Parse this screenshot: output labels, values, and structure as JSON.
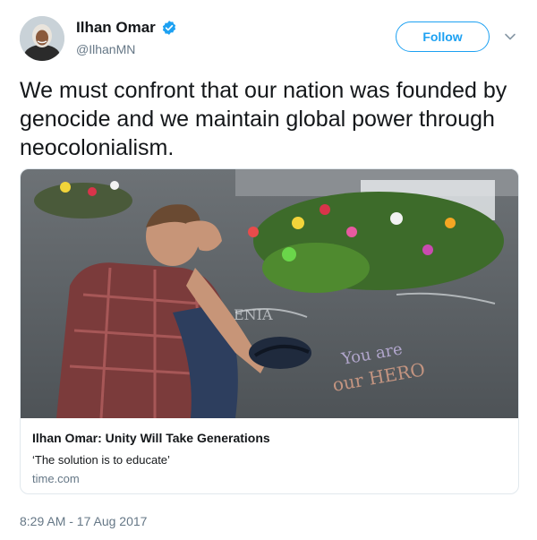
{
  "user": {
    "display_name": "Ilhan Omar",
    "handle": "@IlhanMN",
    "verified": true
  },
  "actions": {
    "follow_label": "Follow"
  },
  "tweet": {
    "text": "We must confront that our nation was founded by genocide and we maintain global power through neocolonialism."
  },
  "card": {
    "title": "Ilhan Omar: Unity Will Take Generations",
    "description": "‘The solution is to educate’",
    "domain": "time.com",
    "image_text": [
      "ENIA",
      "You are",
      "our HERO"
    ]
  },
  "meta": {
    "timestamp": "8:29 AM - 17 Aug 2017"
  },
  "colors": {
    "accent": "#1da1f2",
    "secondary_text": "#657786",
    "border": "#e1e8ed"
  },
  "icons": {
    "verified": "verified-badge-icon",
    "caret": "chevron-down-icon"
  }
}
